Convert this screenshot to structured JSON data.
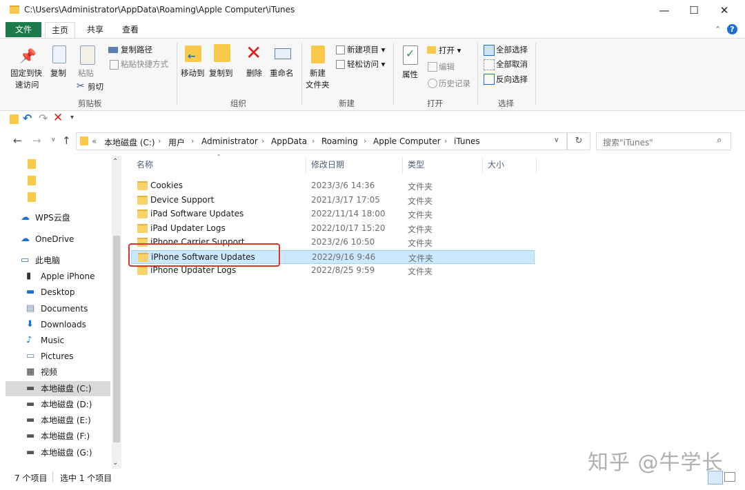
{
  "window": {
    "title": "C:\\Users\\Administrator\\AppData\\Roaming\\Apple Computer\\iTunes",
    "minimize": "—",
    "maximize": "☐",
    "close": "✕"
  },
  "ribbon_tabs": [
    "文件",
    "主页",
    "共享",
    "查看"
  ],
  "ribbon": {
    "clipboard": {
      "pin_label_1": "固定到快",
      "pin_label_2": "速访问",
      "copy": "复制",
      "paste": "粘贴",
      "copy_path": "复制路径",
      "paste_shortcut": "粘贴快捷方式",
      "cut": "剪切",
      "group": "剪贴板"
    },
    "organize": {
      "move_to": "移动到",
      "copy_to": "复制到",
      "delete": "删除",
      "rename": "重命名",
      "group": "组织"
    },
    "new": {
      "new_folder_1": "新建",
      "new_folder_2": "文件夹",
      "new_item": "新建项目 ▾",
      "easy_access": "轻松访问 ▾",
      "group": "新建"
    },
    "open": {
      "properties": "属性",
      "open": "打开 ▾",
      "edit": "编辑",
      "history": "历史记录",
      "group": "打开"
    },
    "select": {
      "select_all": "全部选择",
      "select_none": "全部取消",
      "invert": "反向选择",
      "group": "选择"
    }
  },
  "address": {
    "overflow": "«",
    "crumbs": [
      "本地磁盘 (C:)",
      "用户",
      "Administrator",
      "AppData",
      "Roaming",
      "Apple Computer",
      "iTunes"
    ],
    "search_placeholder": "搜索\"iTunes\""
  },
  "nav": {
    "items": [
      {
        "label": "WPS云盘",
        "icon": "cloud-icon"
      },
      {
        "label": "OneDrive",
        "icon": "onedrive-icon"
      },
      {
        "label": "此电脑",
        "icon": "computer-icon"
      },
      {
        "label": "Apple iPhone",
        "icon": "phone-icon"
      },
      {
        "label": "Desktop",
        "icon": "desktop-icon"
      },
      {
        "label": "Documents",
        "icon": "documents-icon"
      },
      {
        "label": "Downloads",
        "icon": "downloads-icon"
      },
      {
        "label": "Music",
        "icon": "music-icon"
      },
      {
        "label": "Pictures",
        "icon": "pictures-icon"
      },
      {
        "label": "视频",
        "icon": "video-icon"
      },
      {
        "label": "本地磁盘 (C:)",
        "icon": "drive-icon",
        "selected": true
      },
      {
        "label": "本地磁盘 (D:)",
        "icon": "drive-icon"
      },
      {
        "label": "本地磁盘 (E:)",
        "icon": "drive-icon"
      },
      {
        "label": "本地磁盘 (F:)",
        "icon": "drive-icon"
      },
      {
        "label": "本地磁盘 (G:)",
        "icon": "drive-icon"
      }
    ]
  },
  "columns": {
    "name": "名称",
    "date": "修改日期",
    "type": "类型",
    "size": "大小"
  },
  "files": [
    {
      "name": "Cookies",
      "date": "2023/3/6 14:36",
      "type": "文件夹"
    },
    {
      "name": "Device Support",
      "date": "2021/3/17 17:05",
      "type": "文件夹"
    },
    {
      "name": "iPad Software Updates",
      "date": "2022/11/14 18:00",
      "type": "文件夹"
    },
    {
      "name": "iPad Updater Logs",
      "date": "2022/10/17 15:20",
      "type": "文件夹"
    },
    {
      "name": "iPhone Carrier Support",
      "date": "2023/2/6 10:50",
      "type": "文件夹"
    },
    {
      "name": "iPhone Software Updates",
      "date": "2022/9/16 9:46",
      "type": "文件夹",
      "selected": true
    },
    {
      "name": "iPhone Updater Logs",
      "date": "2022/8/25 9:59",
      "type": "文件夹"
    }
  ],
  "status": {
    "count": "7 个项目",
    "selected": "选中 1 个项目"
  },
  "watermark": "知乎 @牛学长",
  "colors": {
    "file_tab": "#1e7a4a",
    "selection": "#cce8ff",
    "highlight_box": "#e0322b"
  }
}
